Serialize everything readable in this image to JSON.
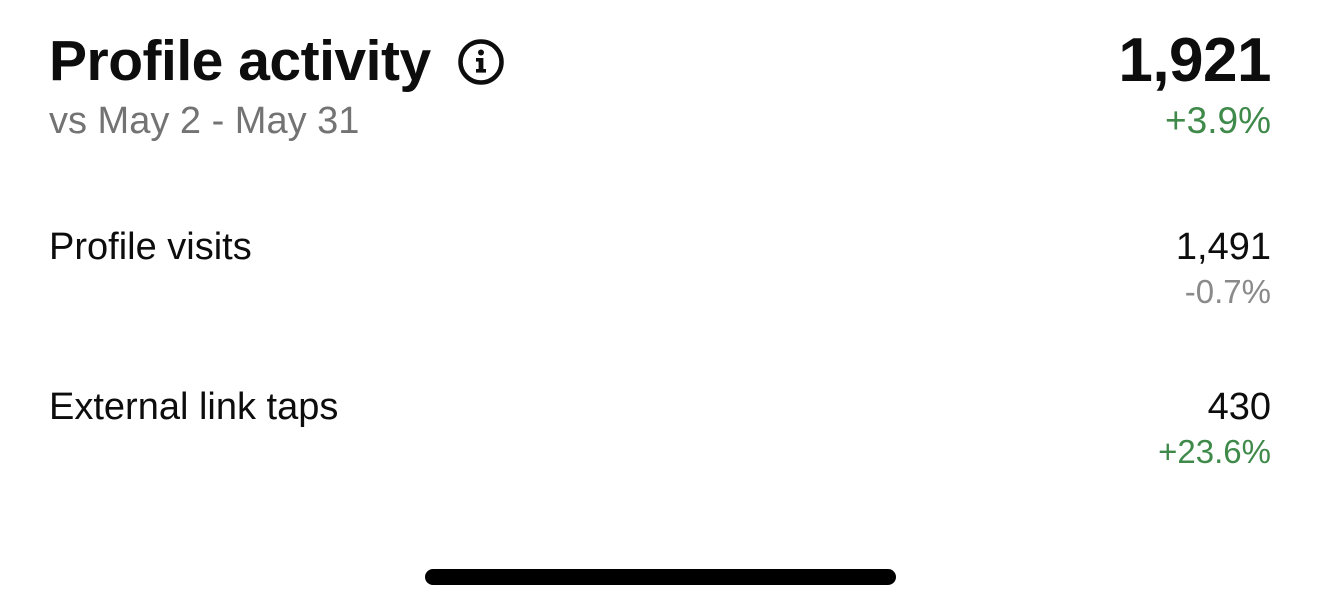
{
  "colors": {
    "positive": "#3f8a4a",
    "neutral": "#8a8a8a",
    "text": "#0d0d0d",
    "muted": "#737373"
  },
  "header": {
    "title": "Profile activity",
    "info_icon": "info-circle-icon",
    "subtitle": "vs May 2 - May 31",
    "total_value": "1,921",
    "total_change": "+3.9%",
    "total_change_trend": "positive"
  },
  "metrics": [
    {
      "label": "Profile visits",
      "value": "1,491",
      "change": "-0.7%",
      "trend": "neutral"
    },
    {
      "label": "External link taps",
      "value": "430",
      "change": "+23.6%",
      "trend": "positive"
    }
  ]
}
